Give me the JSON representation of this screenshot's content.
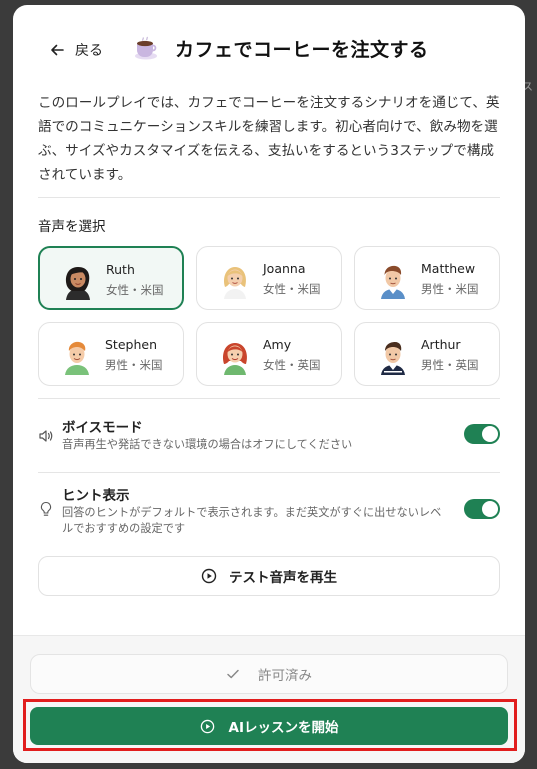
{
  "background": {
    "partial_text": "ス"
  },
  "header": {
    "back_label": "戻る",
    "title": "カフェでコーヒーを注文する",
    "title_icon": "coffee-cup-icon"
  },
  "description": "このロールプレイでは、カフェでコーヒーを注文するシナリオを通じて、英語でのコミュニケーションスキルを練習します。初心者向けで、飲み物を選ぶ、サイズやカスタマイズを伝える、支払いをするという3ステップで構成されています。",
  "voice_section": {
    "label": "音声を選択",
    "selected": "Ruth",
    "voices": [
      {
        "name": "Ruth",
        "meta": "女性・米国"
      },
      {
        "name": "Joanna",
        "meta": "女性・米国"
      },
      {
        "name": "Matthew",
        "meta": "男性・米国"
      },
      {
        "name": "Stephen",
        "meta": "男性・米国"
      },
      {
        "name": "Amy",
        "meta": "女性・英国"
      },
      {
        "name": "Arthur",
        "meta": "男性・英国"
      }
    ]
  },
  "settings": {
    "voice_mode": {
      "title": "ボイスモード",
      "description": "音声再生や発話できない環境の場合はオフにしてください",
      "enabled": true,
      "icon": "speaker-icon"
    },
    "hints": {
      "title": "ヒント表示",
      "description": "回答のヒントがデフォルトで表示されます。まだ英文がすぐに出せないレベルでおすすめの設定です",
      "enabled": true,
      "icon": "lightbulb-icon"
    }
  },
  "test_audio_label": "テスト音声を再生",
  "footer": {
    "permitted_label": "許可済み",
    "start_label": "AIレッスンを開始"
  },
  "colors": {
    "accent": "#1f8154",
    "highlight": "#e11d1d"
  }
}
